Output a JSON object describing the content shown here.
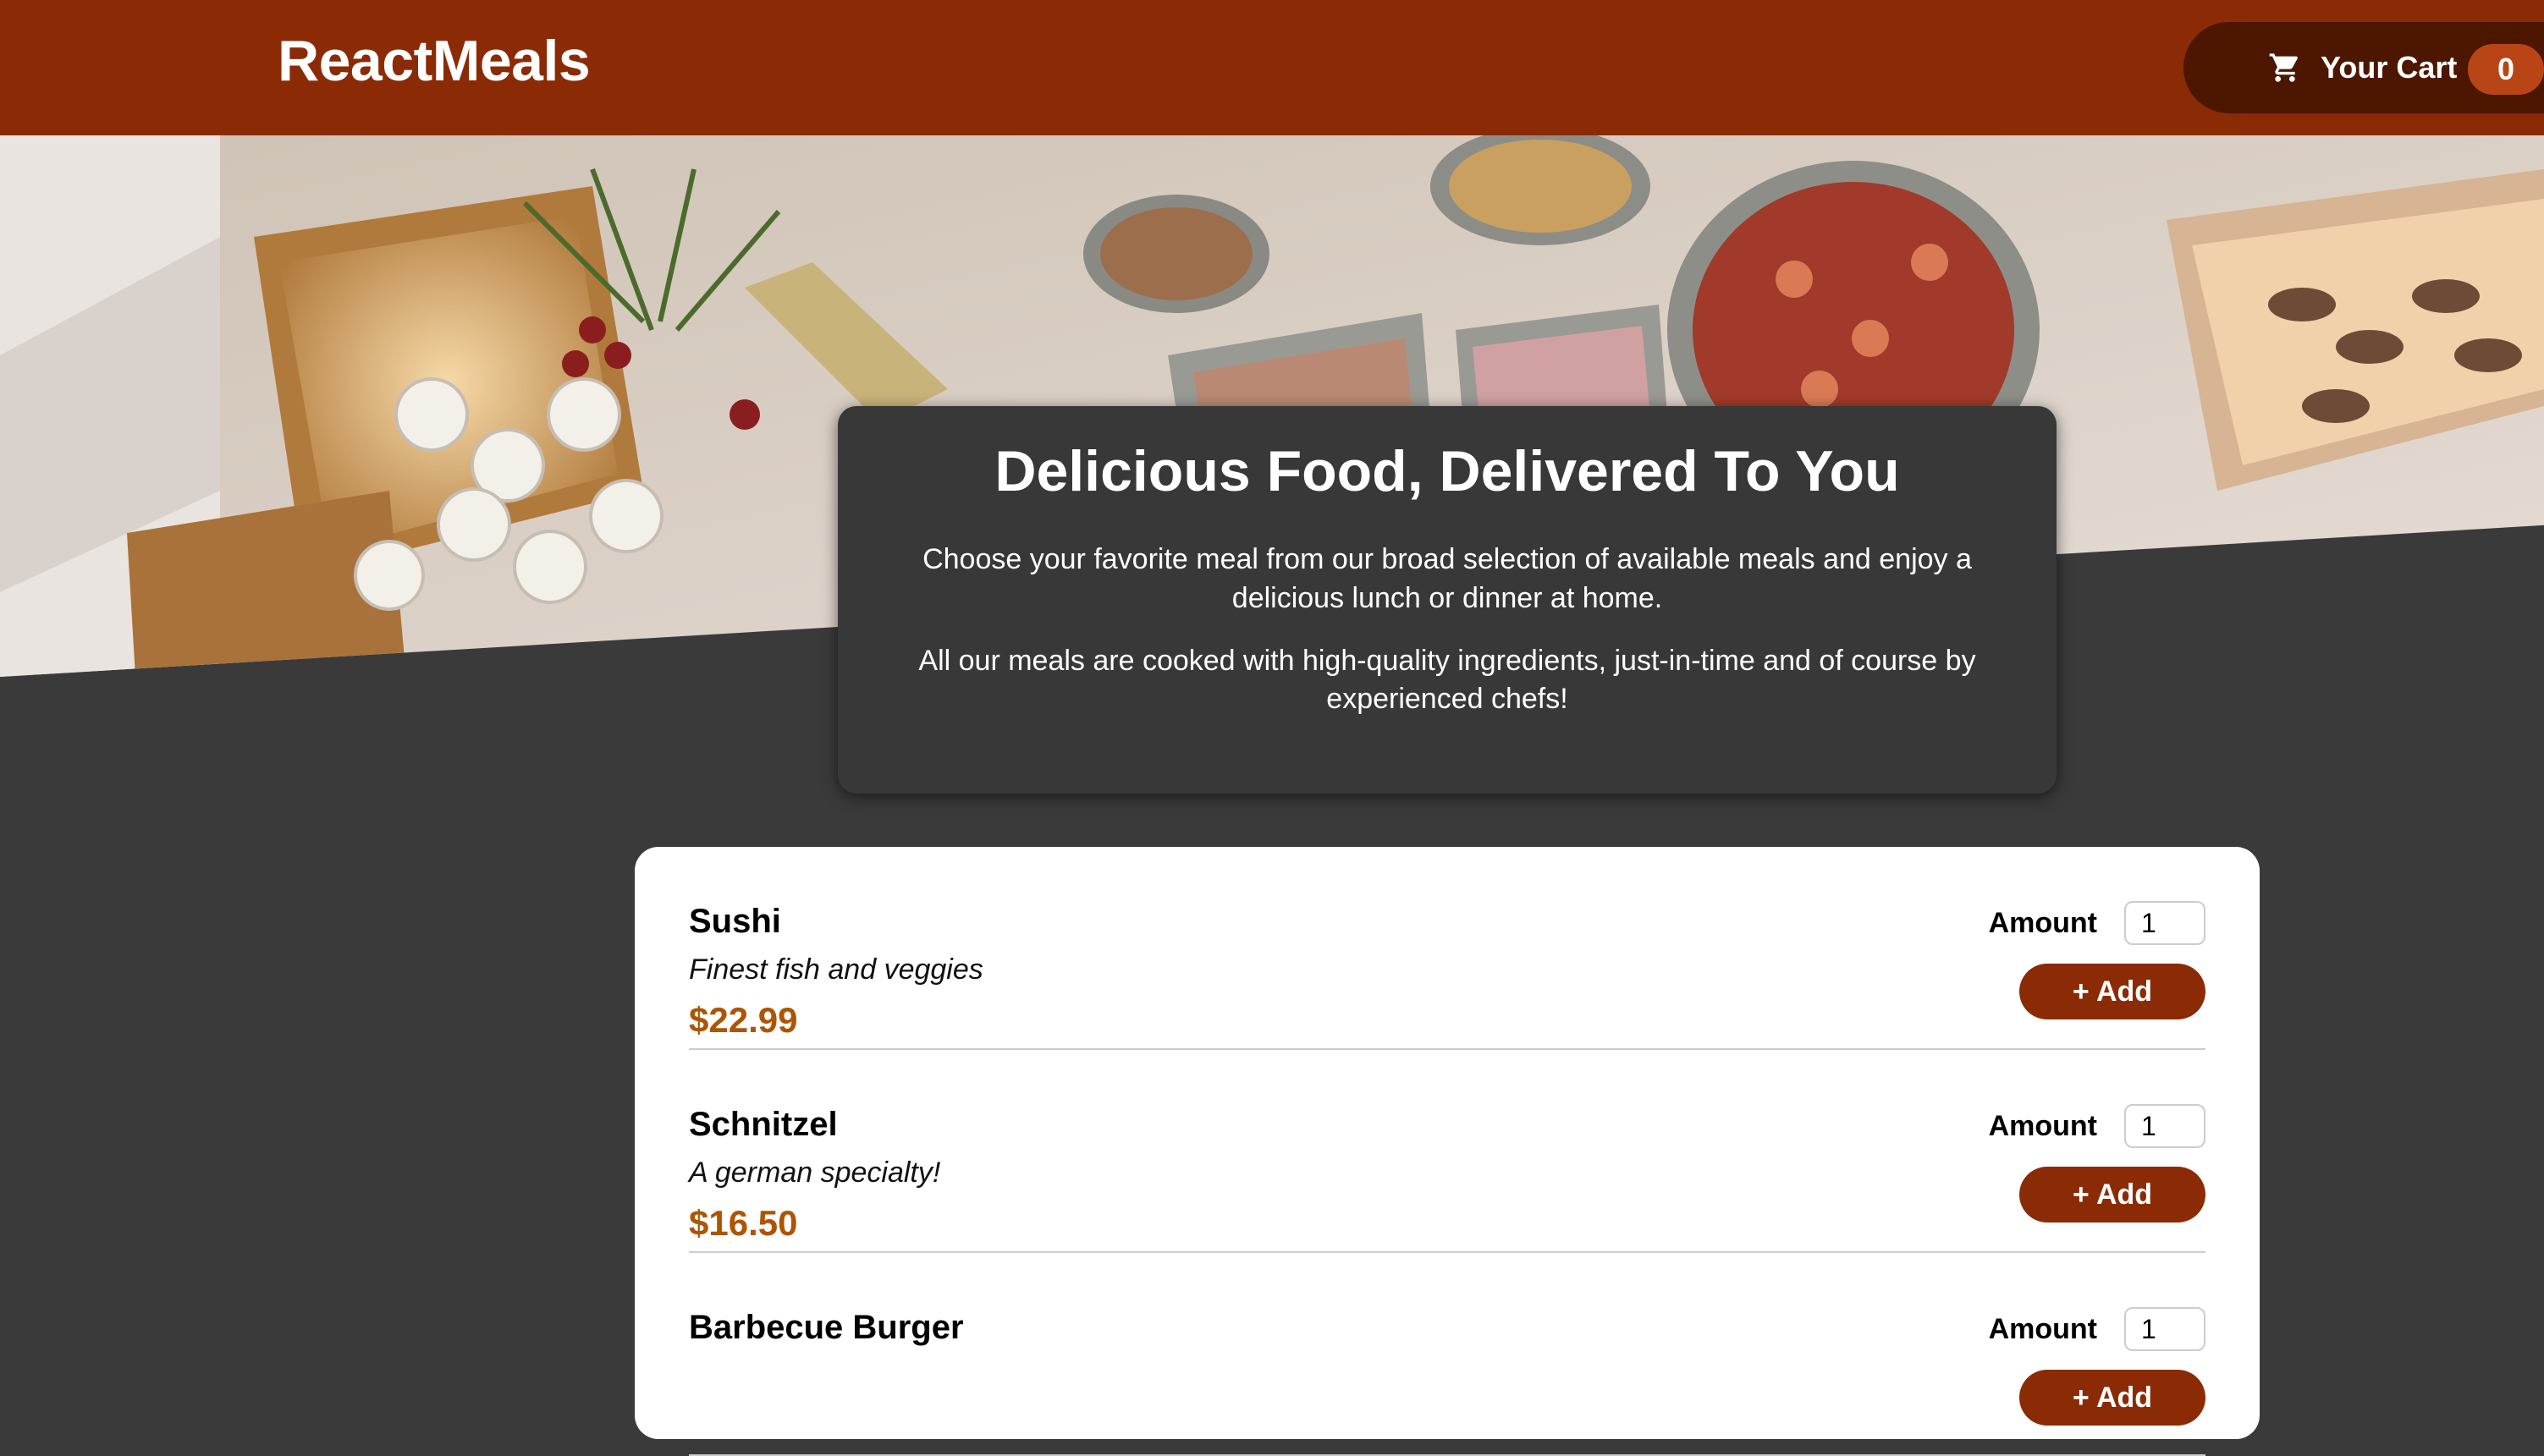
{
  "header": {
    "brand": "ReactMeals",
    "cart": {
      "label": "Your Cart",
      "count": "0",
      "icon": "cart-icon"
    }
  },
  "hero": {
    "image": "food-buffet-image"
  },
  "summary": {
    "title": "Delicious Food, Delivered To You",
    "paragraph1": "Choose your favorite meal from our broad selection of available meals and enjoy a delicious lunch or dinner at home.",
    "paragraph2": "All our meals are cooked with high-quality ingredients, just-in-time and of course by experienced chefs!"
  },
  "meals": [
    {
      "name": "Sushi",
      "description": "Finest fish and veggies",
      "price": "$22.99",
      "amount_label": "Amount",
      "amount_value": "1",
      "add_label": "+ Add"
    },
    {
      "name": "Schnitzel",
      "description": "A german specialty!",
      "price": "$16.50",
      "amount_label": "Amount",
      "amount_value": "1",
      "add_label": "+ Add"
    },
    {
      "name": "Barbecue Burger",
      "description": "",
      "price": "",
      "amount_label": "Amount",
      "amount_value": "1",
      "add_label": "+ Add"
    }
  ],
  "colors": {
    "header_bg": "#8a2b06",
    "cart_bg": "#4d1601",
    "badge_bg": "#b94517",
    "page_bg": "#3a3a3a",
    "price": "#ad5502"
  }
}
